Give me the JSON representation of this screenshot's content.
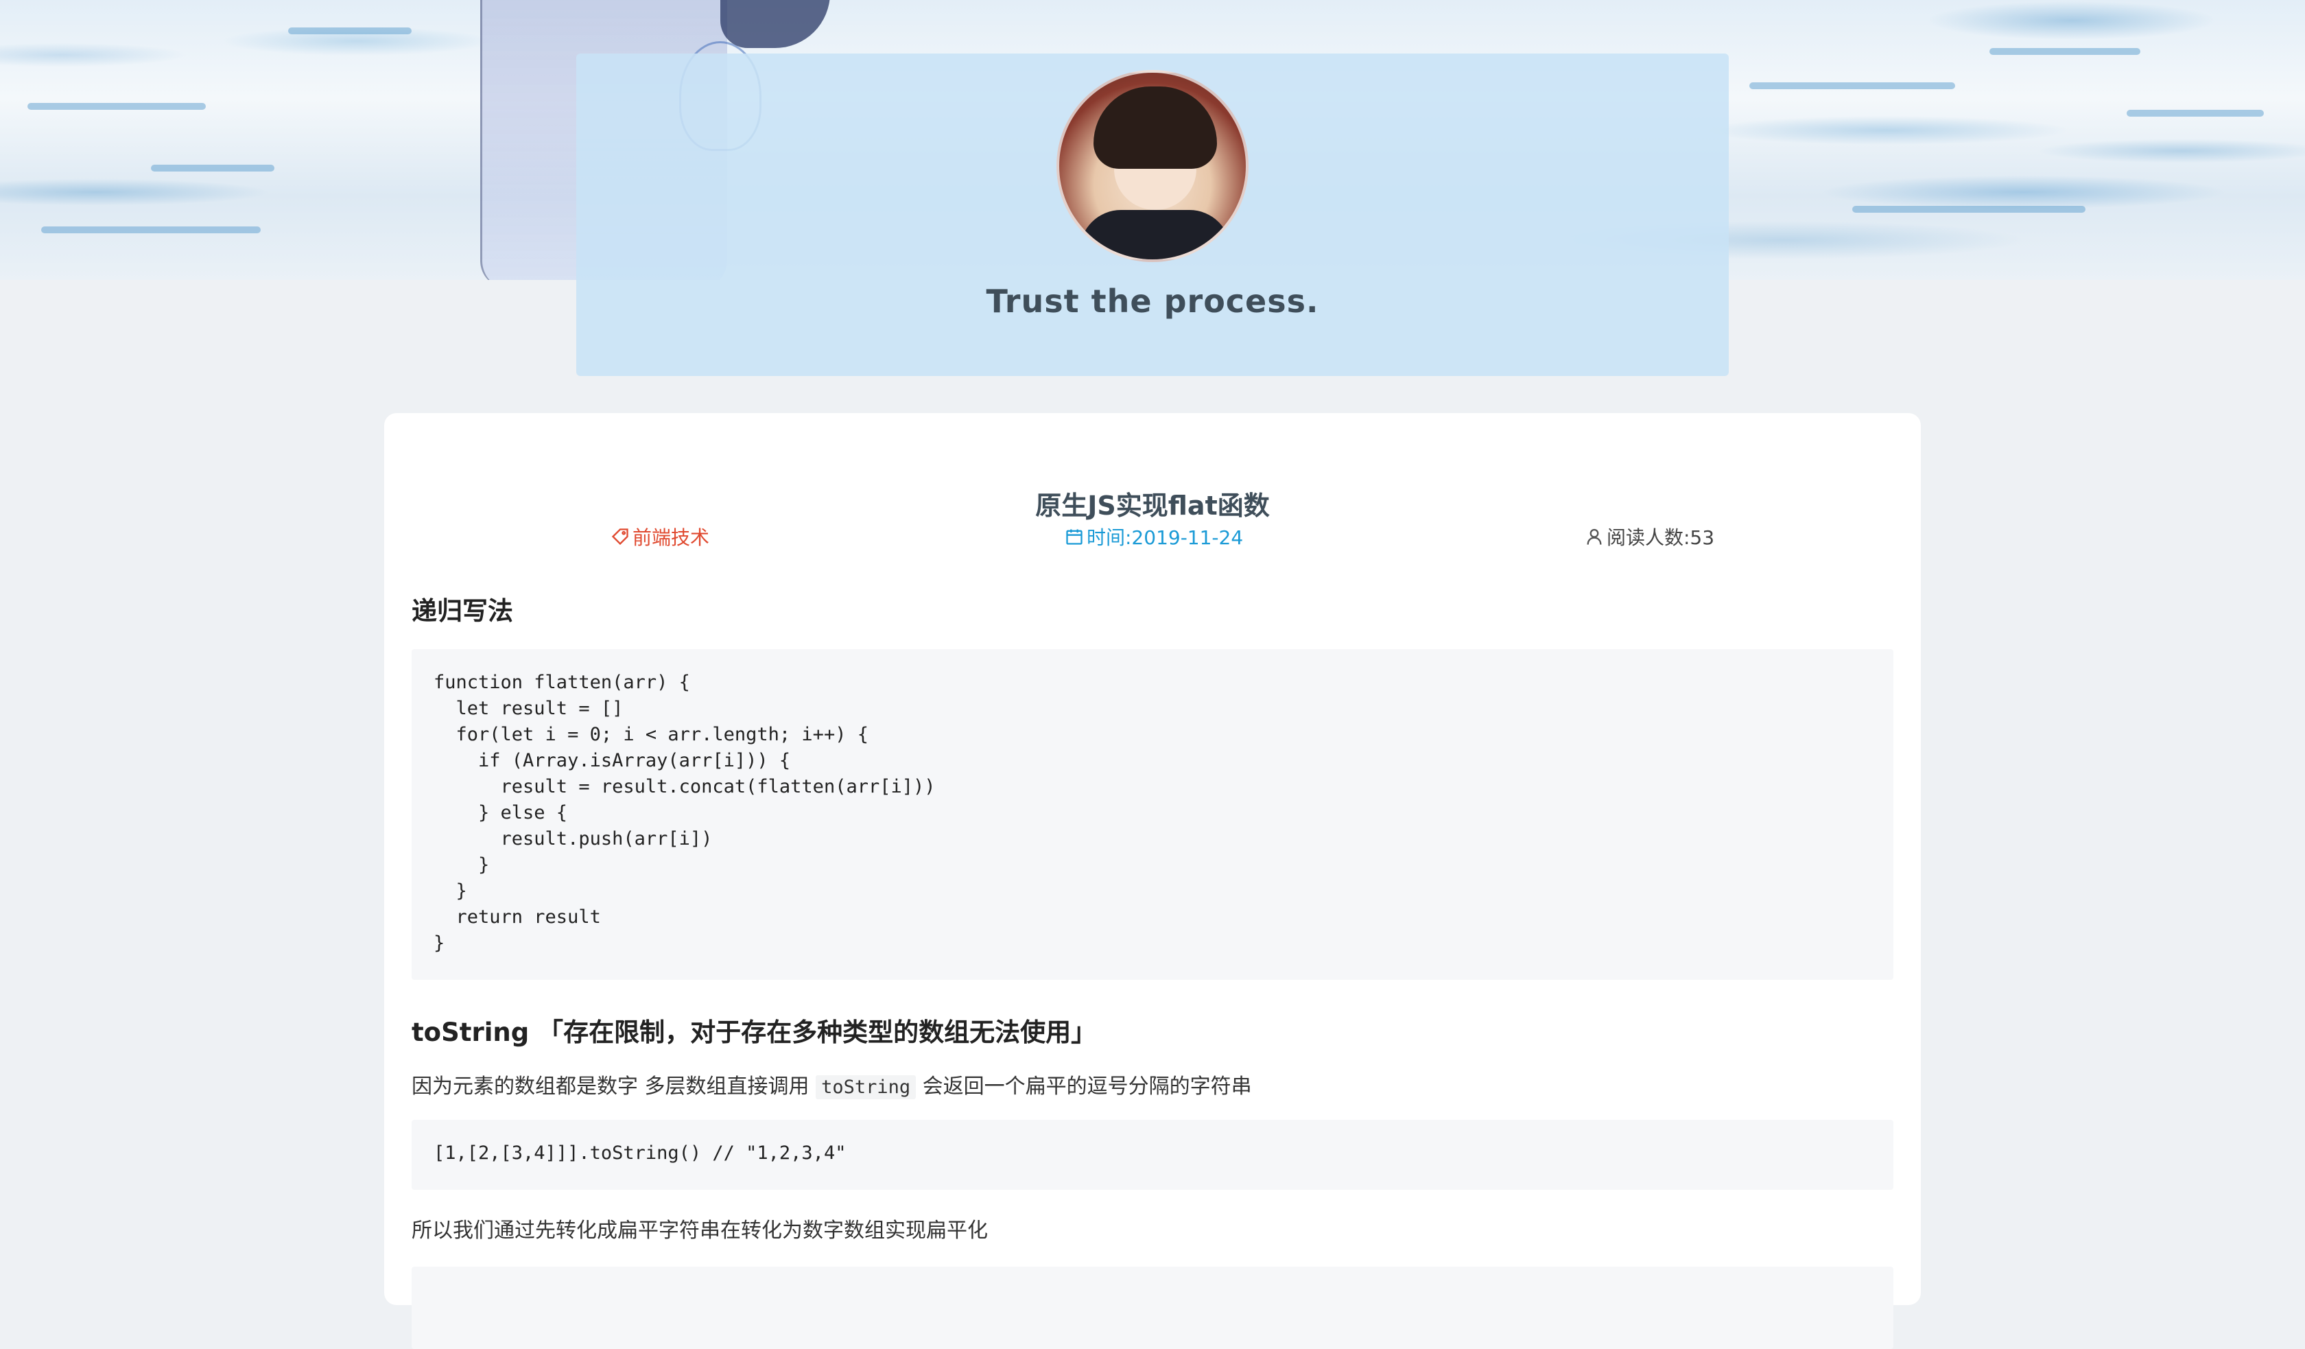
{
  "hero": {
    "motto": "Trust the process."
  },
  "article": {
    "title": "原生JS实现flat函数",
    "meta": {
      "tag": "前端技术",
      "date": "时间:2019-11-24",
      "reads": "阅读人数:53"
    },
    "sections": {
      "recursive_heading": "递归写法",
      "recursive_code": "function flatten(arr) {\n  let result = []\n  for(let i = 0; i < arr.length; i++) {\n    if (Array.isArray(arr[i])) {\n      result = result.concat(flatten(arr[i]))\n    } else {\n      result.push(arr[i])\n    }\n  }\n  return result\n}",
      "tostring_heading": "toString 「存在限制，对于存在多种类型的数组无法使用」",
      "tostring_para_before": "因为元素的数组都是数字 多层数组直接调用 ",
      "tostring_inline_code": "toString",
      "tostring_para_after": " 会返回一个扁平的逗号分隔的字符串",
      "tostring_code": "[1,[2,[3,4]]].toString() // \"1,2,3,4\"",
      "conclusion_para": "所以我们通过先转化成扁平字符串在转化为数字数组实现扁平化"
    }
  },
  "colors": {
    "tag": "#e0492f",
    "date": "#1a9ad6",
    "header_card": "#c8e3f6"
  },
  "icons": {
    "tag": "tag-icon",
    "date": "calendar-icon",
    "reads": "user-icon"
  }
}
